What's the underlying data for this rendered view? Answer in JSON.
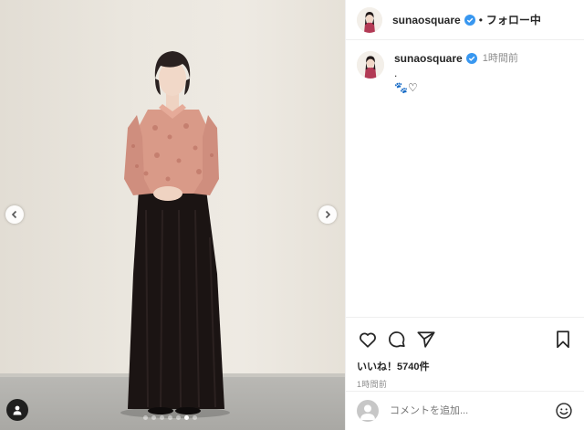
{
  "post": {
    "username": "sunaosquare",
    "follow_status": "フォロー中",
    "separator": "•",
    "caption_username": "sunaosquare",
    "caption_time": "1時間前",
    "caption_line1": ".",
    "caption_line2": "🐾♡",
    "likes_text": "いいね！5740件",
    "posted_time": "1時間前",
    "comment_placeholder": "コメントを追加...",
    "carousel": {
      "total": 7,
      "active": 6
    }
  },
  "icons": {
    "prev": "chevron-left-icon",
    "next": "chevron-right-icon",
    "tag": "user-tag-icon",
    "verified": "verified-badge-icon",
    "like": "heart-icon",
    "comment": "comment-bubble-icon",
    "share": "paper-plane-icon",
    "save": "bookmark-icon",
    "emoji": "smiley-icon"
  },
  "colors": {
    "verified": "#3897f0",
    "text": "#262626",
    "muted": "#8e8e8e",
    "border": "#efefef"
  }
}
